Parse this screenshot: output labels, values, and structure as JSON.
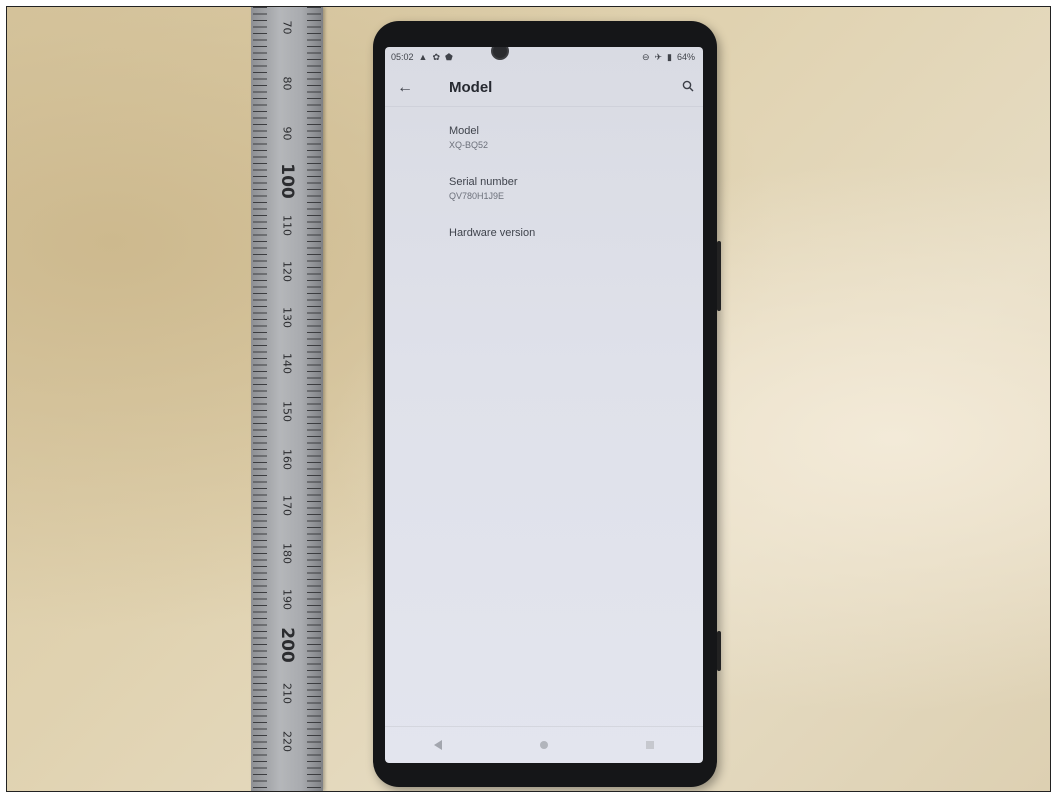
{
  "status_bar": {
    "time": "05:02",
    "left_icons": [
      "warning-icon",
      "settings-icon",
      "shield-icon"
    ],
    "right_icons": [
      "dnd-icon",
      "airplane-icon",
      "battery-icon"
    ],
    "battery": "64%"
  },
  "app_bar": {
    "title": "Model"
  },
  "items": [
    {
      "title": "Model",
      "value": "XQ-BQ52"
    },
    {
      "title": "Serial number",
      "value": "QV780H1J9E"
    },
    {
      "title": "Hardware version",
      "value": ""
    }
  ],
  "nav_bar": [
    "back",
    "home",
    "recents"
  ],
  "ruler": {
    "labels": [
      "70",
      "80",
      "90",
      "100",
      "110",
      "120",
      "130",
      "140",
      "150",
      "160",
      "170",
      "180",
      "190",
      "200",
      "210",
      "220"
    ]
  }
}
